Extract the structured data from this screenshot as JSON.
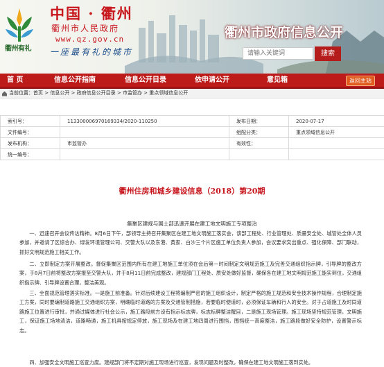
{
  "header": {
    "logo_text": "衢州有礼",
    "brand_cn": "中国 · 衢州",
    "gov_cn": "衢州市人民政府",
    "domain": "www.qz.gov.cn",
    "slogan": "一座最有礼的城市",
    "site_title": "衢州市政府信息公开",
    "search_placeholder": "请输入关键词",
    "search_button": "搜索"
  },
  "nav": {
    "items": [
      "首 页",
      "信息公开指南",
      "信息公开目录",
      "依申请公开",
      "意见箱"
    ],
    "back_home": "返回主站"
  },
  "breadcrumb": "当前位置：首页 > 信息公开 > 政府信息公开目录 > 市监管办 > 重点领域信息公开",
  "meta": {
    "rows": [
      {
        "k1": "索引号：",
        "v1": "113300006970169334/2020-110250",
        "k2": "发布日期：",
        "v2": "2020-07-17"
      },
      {
        "k1": "文件编号：",
        "v1": "",
        "k2": "组配分类：",
        "v2": "重点领域信息公开"
      },
      {
        "k1": "发布机构：",
        "v1": "市监管办",
        "k2": "有效性：",
        "v2": ""
      },
      {
        "k1": "统一编号：",
        "v1": "",
        "k2": "",
        "v2": ""
      }
    ]
  },
  "article": {
    "title": "衢州住房和城乡建设信息（2018）第20期",
    "subtitle": "集聚区建规与国土部迅速开展在建工地文明施工专项整治",
    "paragraphs": [
      "一、迅速召开会议传达精神。8月6日下午，部领导主持召开集聚区在建工地文明施工落实会，该部工程处、行业管理处、质量安全处、城管处全体人员参加，并邀请了区综合办、绿发环境管理公司、交警大队以及东港、黄家、白沙三个片区施工单位负责人参加，会议要求突出重点、强化保障、部门联动，抓好文明规范施工相关工作。",
      "二、立即制定方案开展整改。督促集聚区范围内所有在建工地施工单位须在会后第一时间制定文明规范施工及完善交通组织指示牌，引导牌的整改方案，于8月7日前将整改方案报至交警大队，并于8月11日前完成整改，建规部门工程处、质安处做好监督，确保各在建工地文明规范施工能实到位，交通组织指示牌、引导牌设置合理，整洁美观。",
      "三、全面规范管理落实标准。一是施工前准备。针对后续建设工程将编制严密的施工组织设计，制定严格的施工规范和安全技术操作规程，合理制定施工方案，同时要编制道路施工交通组织方案，明确临时道路的方案及交通管制措施，若要临时便道时，必须保证车辆和行人的安全。对于占道施工及时同道路施工位置进行审批，并通过媒体进行社会公示，施工路段前方设有指示标志牌，标志标牌整洁醒目，二是施工现场管理。施工现场坚持规范管理，文明施工，保证施工场地清洁，道路畅通，施工机具按规定停放，施工现场及在建工地四周进行围挡，围挡统一高度整洁，施工路段做好安全防护，设置警示标志。",
      "四、加强安全文明施工巡查力度。建规部门将不定期对施工现场进行巡查，发现问题及时整改，确保在建工地文明施工落到实处。"
    ]
  }
}
